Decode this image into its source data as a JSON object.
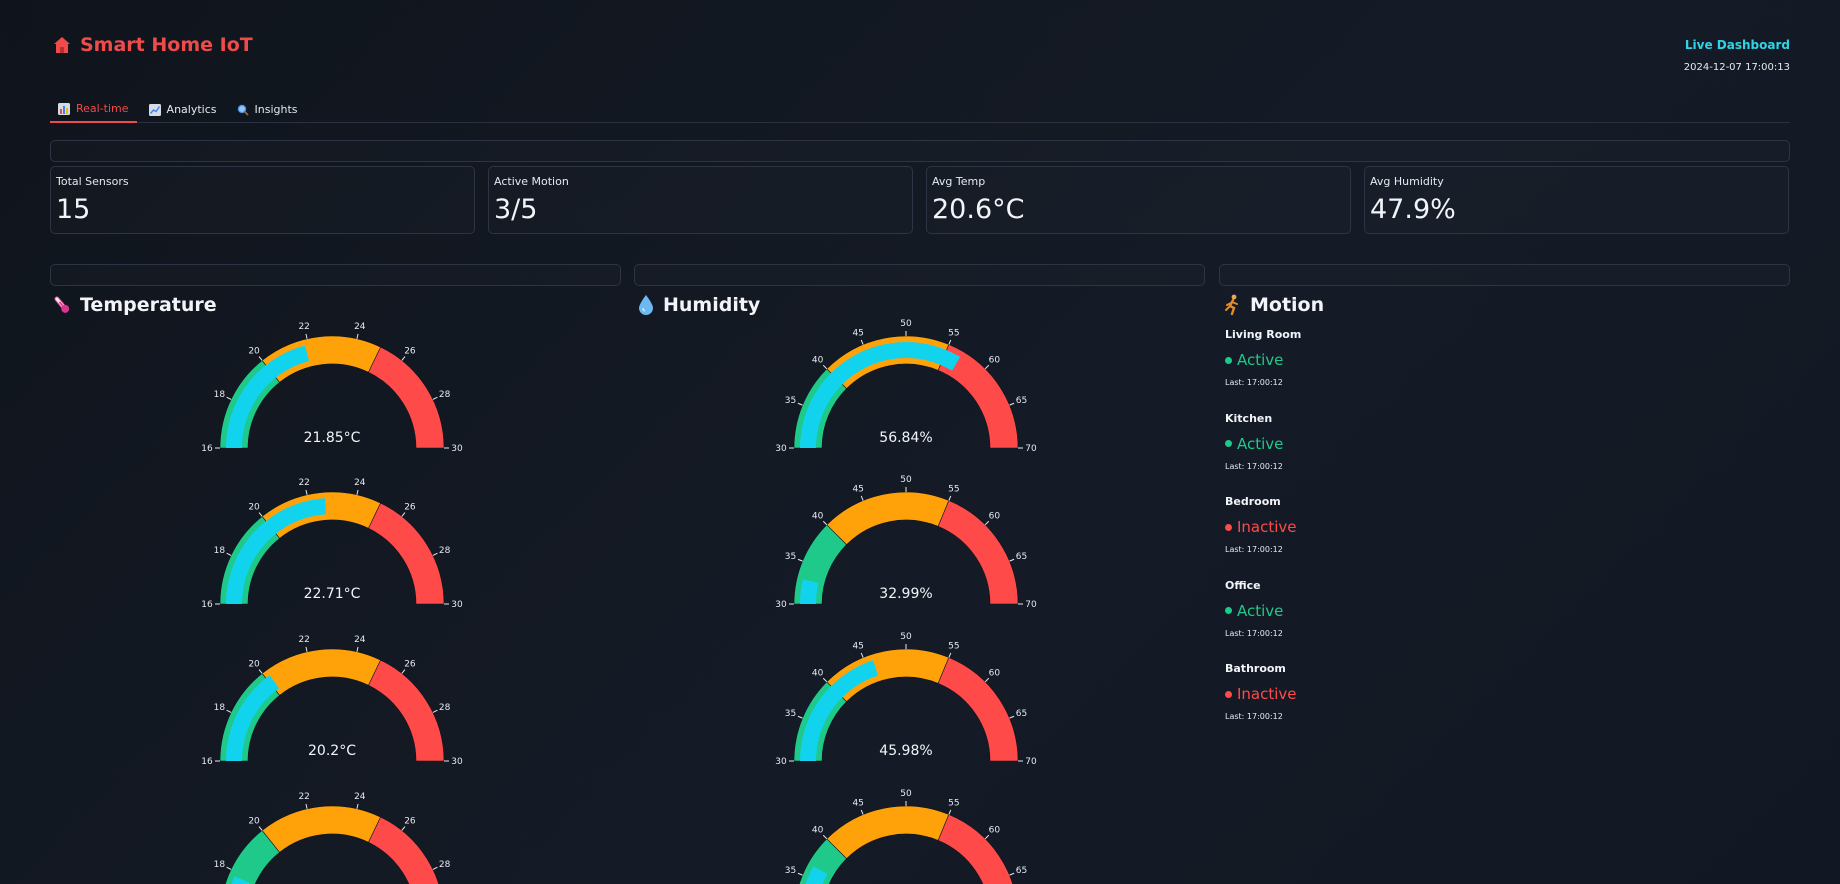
{
  "header": {
    "icon": "house-icon",
    "title": "Smart Home IoT",
    "live_label": "Live Dashboard",
    "timestamp": "2024-12-07 17:00:13"
  },
  "tabs": [
    {
      "icon": "bar-chart-icon",
      "label": "Real-time",
      "active": true
    },
    {
      "icon": "trend-chart-icon",
      "label": "Analytics",
      "active": false
    },
    {
      "icon": "magnifier-icon",
      "label": "Insights",
      "active": false
    }
  ],
  "metrics": [
    {
      "label": "Total Sensors",
      "value": "15"
    },
    {
      "label": "Active Motion",
      "value": "3/5"
    },
    {
      "label": "Avg Temp",
      "value": "20.6°C"
    },
    {
      "label": "Avg Humidity",
      "value": "47.9%"
    }
  ],
  "sections": {
    "temperature": {
      "icon": "thermometer-icon",
      "title": "Temperature"
    },
    "humidity": {
      "icon": "droplet-icon",
      "title": "Humidity"
    },
    "motion": {
      "icon": "running-person-icon",
      "title": "Motion"
    }
  },
  "colors": {
    "green": "#1fc98a",
    "orange": "#ffa20a",
    "red": "#ff4a4a",
    "bar": "#12d3ee",
    "accent_red": "#ef4b4b",
    "accent_cyan": "#2fd4e6"
  },
  "temperature_gauges": [
    {
      "value": 21.85,
      "display": "21.85°C"
    },
    {
      "value": 22.71,
      "display": "22.71°C"
    },
    {
      "value": 20.2,
      "display": "20.2°C"
    },
    {
      "value": 17.8,
      "display": ""
    }
  ],
  "temperature_scale": {
    "min": 16,
    "max": 30,
    "ticks": [
      "16",
      "18",
      "20",
      "22",
      "24",
      "26",
      "28",
      "30"
    ],
    "tick_values": [
      16,
      18,
      20,
      22,
      24,
      26,
      28,
      30
    ],
    "bands": [
      {
        "from": 16,
        "to": 20,
        "color": "green"
      },
      {
        "from": 20,
        "to": 25,
        "color": "orange"
      },
      {
        "from": 25,
        "to": 30,
        "color": "red"
      }
    ]
  },
  "humidity_gauges": [
    {
      "value": 56.84,
      "display": "56.84%"
    },
    {
      "value": 32.99,
      "display": "32.99%"
    },
    {
      "value": 45.98,
      "display": "45.98%"
    },
    {
      "value": 36.5,
      "display": ""
    }
  ],
  "humidity_scale": {
    "min": 30,
    "max": 70,
    "ticks": [
      "30",
      "35",
      "40",
      "45",
      "50",
      "55",
      "60",
      "65",
      "70"
    ],
    "tick_values": [
      30,
      35,
      40,
      45,
      50,
      55,
      60,
      65,
      70
    ],
    "bands": [
      {
        "from": 30,
        "to": 40,
        "color": "green"
      },
      {
        "from": 40,
        "to": 55,
        "color": "orange"
      },
      {
        "from": 55,
        "to": 70,
        "color": "red"
      }
    ]
  },
  "motion": [
    {
      "room": "Living Room",
      "status": "Active",
      "active": true,
      "last": "Last: 17:00:12"
    },
    {
      "room": "Kitchen",
      "status": "Active",
      "active": true,
      "last": "Last: 17:00:12"
    },
    {
      "room": "Bedroom",
      "status": "Inactive",
      "active": false,
      "last": "Last: 17:00:12"
    },
    {
      "room": "Office",
      "status": "Active",
      "active": true,
      "last": "Last: 17:00:12"
    },
    {
      "room": "Bathroom",
      "status": "Inactive",
      "active": false,
      "last": "Last: 17:00:12"
    }
  ]
}
